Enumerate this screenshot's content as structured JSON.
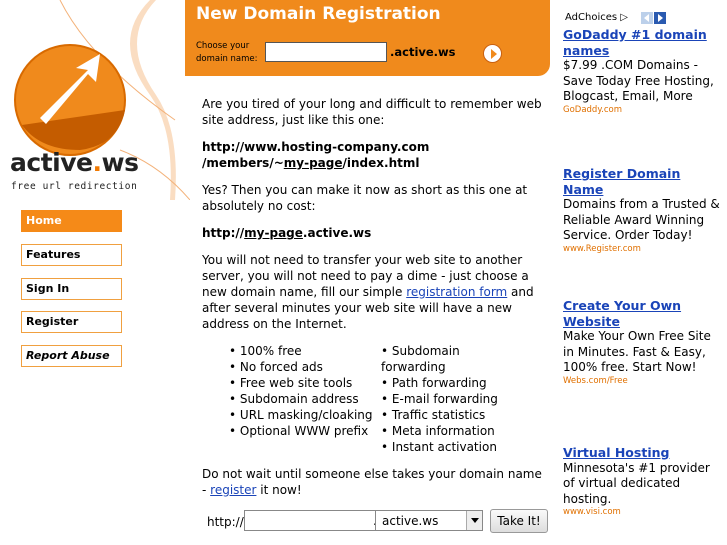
{
  "brand": {
    "part1": "active",
    "part2": ".",
    "part3": "ws",
    "tagline": "free url redirection"
  },
  "nav": [
    {
      "label": "Home",
      "active": true
    },
    {
      "label": "Features"
    },
    {
      "label": "Sign In"
    },
    {
      "label": "Register"
    },
    {
      "label": "Report Abuse"
    }
  ],
  "header": {
    "title": "New Domain Registration",
    "choose_label": "Choose your domain name:",
    "input_value": "",
    "suffix": ".active.ws"
  },
  "main": {
    "p1": "Are you tired of your long and difficult to remember web site address, just like this one:",
    "example_long_1": "http://www.hosting-company.com",
    "example_long_2a": "/members/~",
    "example_long_2b": "my-page",
    "example_long_2c": "/index.html",
    "p2": "Yes? Then you can make it now as short as this one at absolutely no cost:",
    "example_short_a": "http://",
    "example_short_b": "my-page",
    "example_short_c": ".active.ws",
    "p3a": "You will not need to transfer your web site to another server, you will not need to pay a dime - just choose a new domain name, fill our simple ",
    "p3_link": "registration form",
    "p3b": " and after several minutes your web site will have a new address on the Internet.",
    "features_col1": [
      "100% free",
      "No forced ads",
      "Free web site tools",
      "Subdomain address",
      "URL masking/cloaking",
      "Optional WWW prefix"
    ],
    "features_col2": [
      "Subdomain forwarding",
      "Path forwarding",
      "E-mail forwarding",
      "Traffic statistics",
      "Meta information",
      "Instant activation"
    ],
    "p4a": "Do not wait until someone else takes your domain name - ",
    "p4_link": "register",
    "p4b": " it now!"
  },
  "reg_form": {
    "prefix": "http://",
    "input_value": "",
    "dot": ".",
    "selected_domain": "active.ws",
    "button_label": "Take It!"
  },
  "ads": {
    "adchoices_label": "AdChoices",
    "items": [
      {
        "title": "GoDaddy #1 domain names",
        "text": "$7.99 .COM Domains - Save Today Free Hosting, Blogcast, Email, More",
        "url": "GoDaddy.com"
      },
      {
        "title": "Register Domain Name",
        "text": "Domains from a Trusted & Reliable Award Winning Service. Order Today!",
        "url": "www.Register.com"
      },
      {
        "title": "Create Your Own Website",
        "text": "Make Your Own Free Site in Minutes. Fast & Easy, 100% free. Start Now!",
        "url": "Webs.com/Free"
      },
      {
        "title": "Virtual Hosting",
        "text": "Minnesota's #1 provider of virtual dedicated hosting.",
        "url": "www.visi.com"
      }
    ]
  },
  "colors": {
    "accent": "#f08a1c",
    "link": "#1a44b8"
  }
}
